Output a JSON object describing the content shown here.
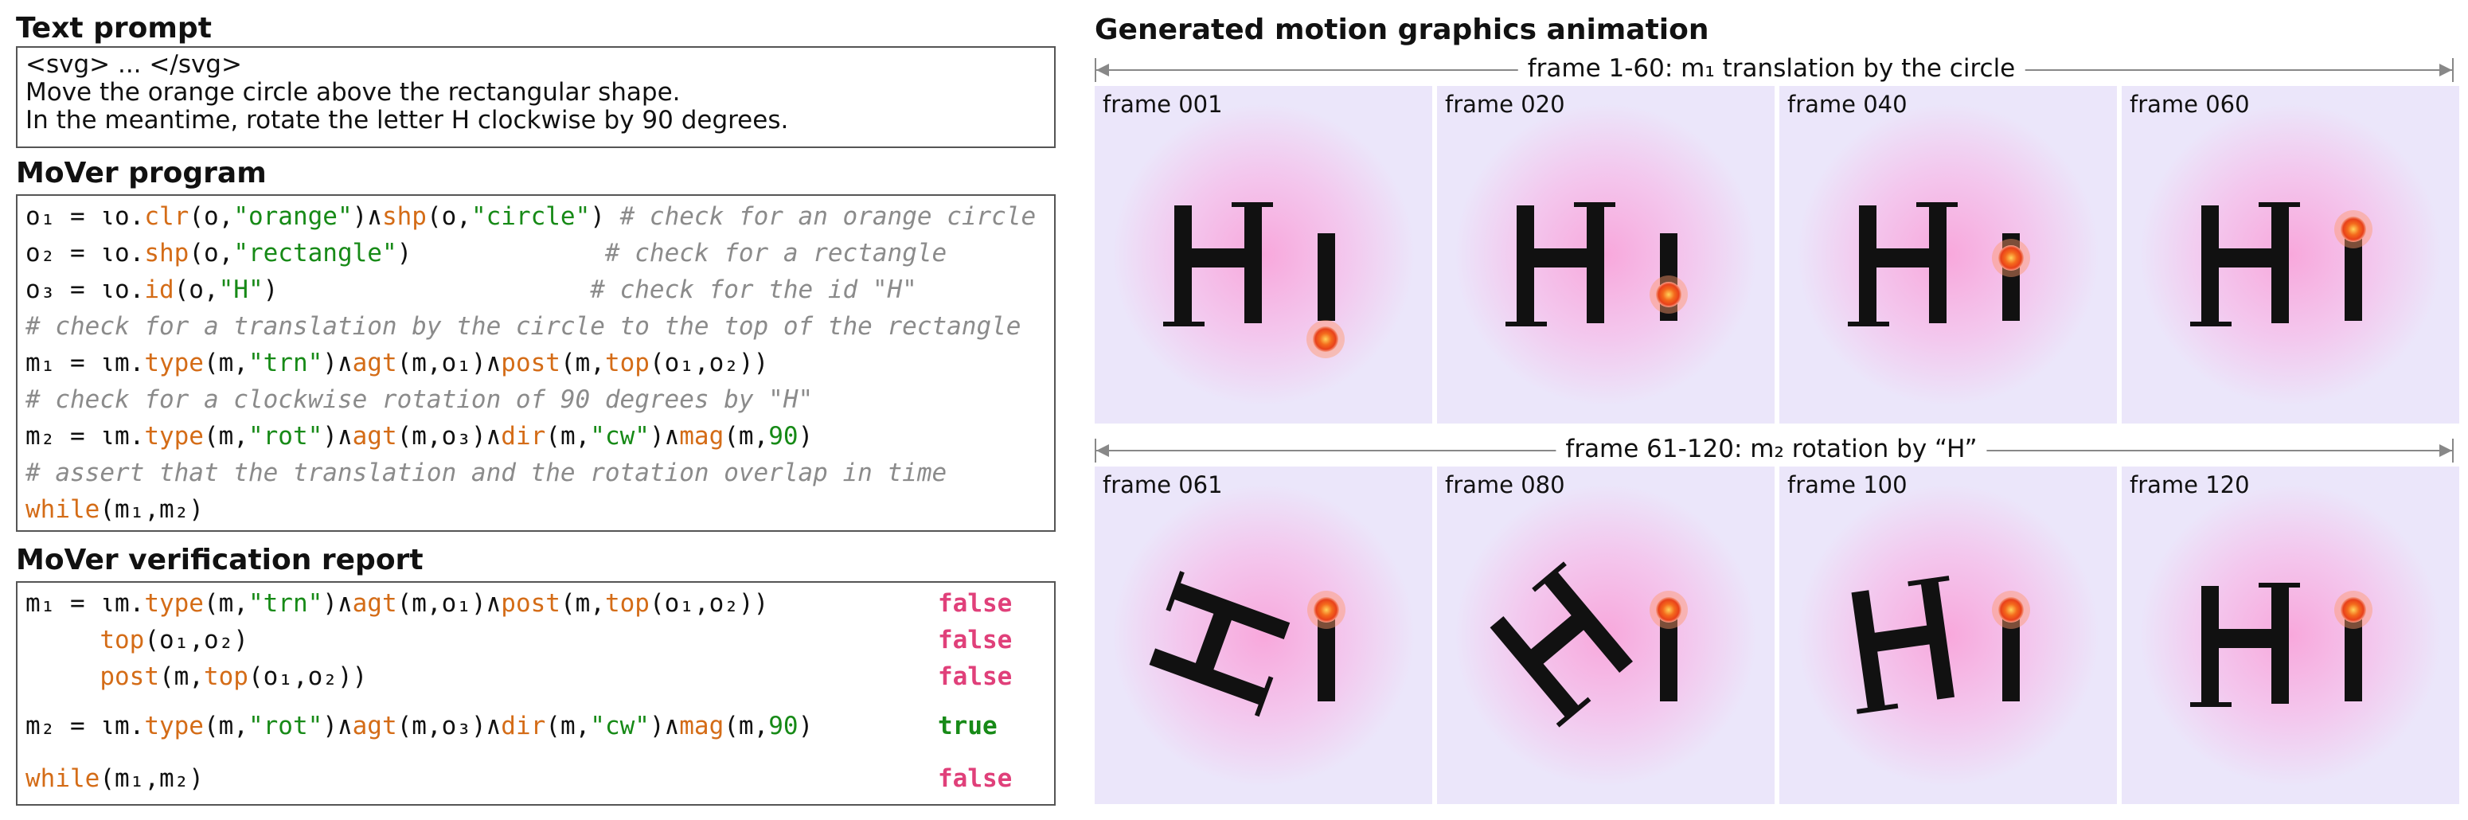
{
  "text_prompt": {
    "title": "Text prompt",
    "lines": [
      "<svg> ... </svg>",
      "Move the orange circle above the rectangular shape.",
      "In the meantime, rotate the letter H clockwise by 90 degrees."
    ]
  },
  "program": {
    "title": "MoVer program",
    "lines": [
      {
        "pre": "o₁ = ιo.",
        "a": "clr",
        "b": "(o,",
        "c": "\"orange\"",
        "d": ")∧",
        "e": "shp",
        "f": "(o,",
        "g": "\"circle\"",
        "h": ") ",
        "cm": "# check for an orange circle"
      },
      {
        "pre": "o₂ = ιo.",
        "a": "shp",
        "b": "(o,",
        "c": "\"rectangle\"",
        "d": ")",
        "pad": "             ",
        "cm": "# check for a rectangle"
      },
      {
        "pre": "o₃ = ιo.",
        "a": "id",
        "b": "(o,",
        "c": "\"H\"",
        "d": ")",
        "pad": "                     ",
        "cm": "# check for the id \"H\""
      },
      {
        "cm_only": "# check for a translation by the circle to the top of the rectangle"
      },
      {
        "m1": true
      },
      {
        "cm_only": "# check for a clockwise rotation of 90 degrees by \"H\""
      },
      {
        "m2": true
      },
      {
        "cm_only": "# assert that the translation and the rotation overlap in time"
      },
      {
        "while": true
      }
    ],
    "comments": {
      "c1": "# check for an orange circle",
      "c2": "# check for a rectangle",
      "c3": "# check for the id \"H\"",
      "c4": "# check for a translation by the circle to the top of the rectangle",
      "c5": "# check for a clockwise rotation of 90 degrees by \"H\"",
      "c6": "# assert that the translation and the rotation overlap in time"
    }
  },
  "report": {
    "title": "MoVer verification report",
    "results": [
      "false",
      "false",
      "false",
      "true",
      "false"
    ]
  },
  "animation": {
    "title": "Generated motion graphics animation",
    "row1_label": "frame 1-60: m₁ translation by the circle",
    "row2_label": "frame 61-120: m₂ rotation by “H”",
    "frames": [
      {
        "label": "frame 001",
        "rotation_deg": 0,
        "circle": "below"
      },
      {
        "label": "frame 020",
        "rotation_deg": 0,
        "circle": "bottom"
      },
      {
        "label": "frame 040",
        "rotation_deg": 0,
        "circle": "middle"
      },
      {
        "label": "frame 060",
        "rotation_deg": 0,
        "circle": "top"
      },
      {
        "label": "frame 061",
        "rotation_deg": -70,
        "circle": "top"
      },
      {
        "label": "frame 080",
        "rotation_deg": -40,
        "circle": "top"
      },
      {
        "label": "frame 100",
        "rotation_deg": -8,
        "circle": "top"
      },
      {
        "label": "frame 120",
        "rotation_deg": 0,
        "circle": "top"
      }
    ]
  },
  "colors": {
    "keyword": "#d46c17",
    "string": "#178a17",
    "comment": "#8b8b8b",
    "false": "#e0407a",
    "true": "#178a17",
    "circle": "#f04a12",
    "glyph": "#111111"
  }
}
